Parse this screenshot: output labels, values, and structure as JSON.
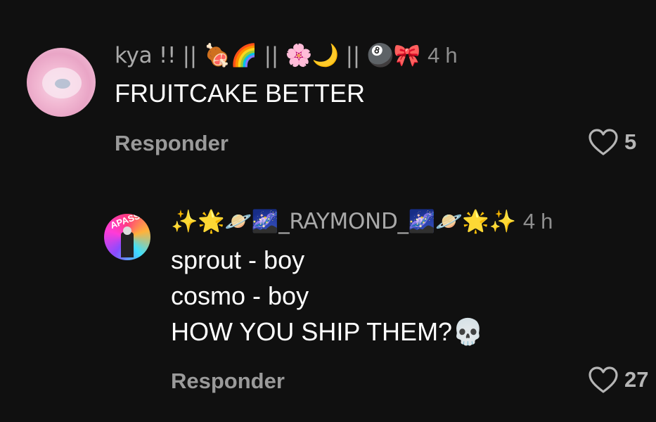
{
  "comments": [
    {
      "username": "kya !! || 🍖🌈 || 🌸🌙 || 🎱🎀",
      "time": "4 h",
      "text": "FRUITCAKE BETTER",
      "reply_label": "Responder",
      "likes": "5",
      "avatar_text": ""
    },
    {
      "username": "✨🌟🪐🌌_RAYMOND_🌌🪐🌟✨",
      "time": "4 h",
      "text_lines": [
        "sprout - boy",
        "cosmo - boy",
        "HOW YOU SHIP THEM?💀"
      ],
      "reply_label": "Responder",
      "likes": "27",
      "avatar_text": "APASS"
    }
  ],
  "icons": {
    "like": "heart-outline-icon"
  }
}
